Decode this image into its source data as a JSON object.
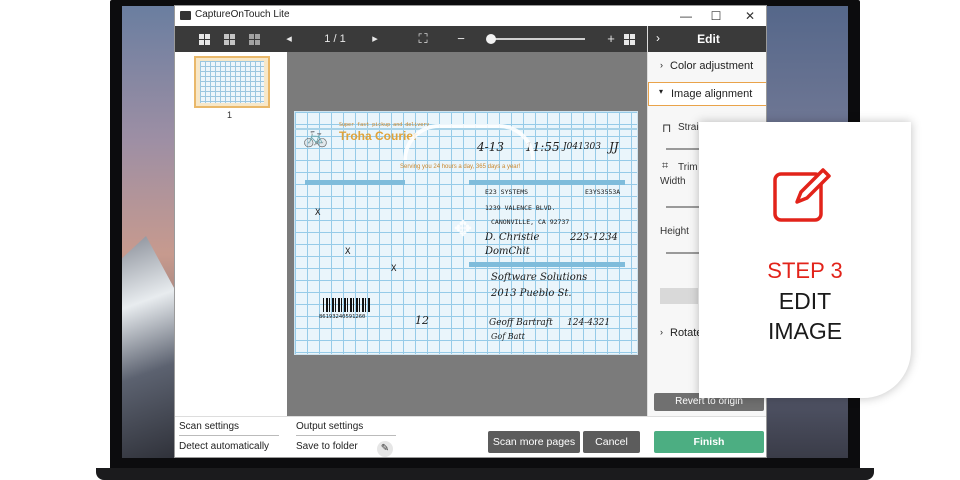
{
  "app": {
    "title": "CaptureOnTouch Lite"
  },
  "window_controls": {
    "minimize": "—",
    "maximize": "☐",
    "close": "✕"
  },
  "toolbar": {
    "view_grid_icons": [
      "grid-view-icon",
      "grid-view-2-icon",
      "grid-view-3-icon"
    ],
    "prev": "◂",
    "page_indicator": "1 / 1",
    "next": "▸",
    "fit_icon": "⛶",
    "zoom_out": "−",
    "zoom_in": "+",
    "zoom_level": 0.0
  },
  "thumbnails": [
    {
      "number": "1"
    }
  ],
  "document": {
    "company_line": "Super fast pickup and delivery",
    "company_name": "Troha Courier",
    "tagline": "Serving you 24 hours a day, 365 days a year!",
    "date": "4-13",
    "time": "11:55",
    "code": "J041303",
    "initials": "JJ",
    "sender_company": "E23 SYSTEMS",
    "sender_code": "E3YS3553A",
    "sender_street": "1239 VALENCE BLVD.",
    "sender_city": "CANONVILLE, CA 92737",
    "contact_name": "D. Christie",
    "contact_phone": "223-1234",
    "contact_sig": "DomChit",
    "recipient_company": "Software Solutions",
    "recipient_street": "2013 Pueblo St.",
    "barcode_number": "86193240591260",
    "box_value": "12",
    "receiver_name": "Geoff Bartraft",
    "receiver_phone": "124-4321",
    "receiver_sig": "Gof Batt",
    "marks": [
      "X",
      "X",
      "X"
    ]
  },
  "edit_panel": {
    "title": "Edit",
    "sections": [
      {
        "label": "Color adjustment",
        "expanded": false
      },
      {
        "label": "Image alignment",
        "expanded": true
      },
      {
        "label": "Rotate",
        "expanded": false
      }
    ],
    "straighten_label": "Straig",
    "trim_label": "Trim",
    "width_label": "Width",
    "height_label": "Height",
    "revert_label": "Revert to origin"
  },
  "bottom": {
    "scan_settings_title": "Scan settings",
    "scan_settings_value": "Detect automatically",
    "output_settings_title": "Output settings",
    "output_settings_value": "Save to folder",
    "scan_more_label": "Scan more pages",
    "cancel_label": "Cancel",
    "finish_label": "Finish"
  },
  "step_card": {
    "step": "STEP 3",
    "line1": "EDIT",
    "line2": "IMAGE",
    "accent": "#e2231a"
  }
}
